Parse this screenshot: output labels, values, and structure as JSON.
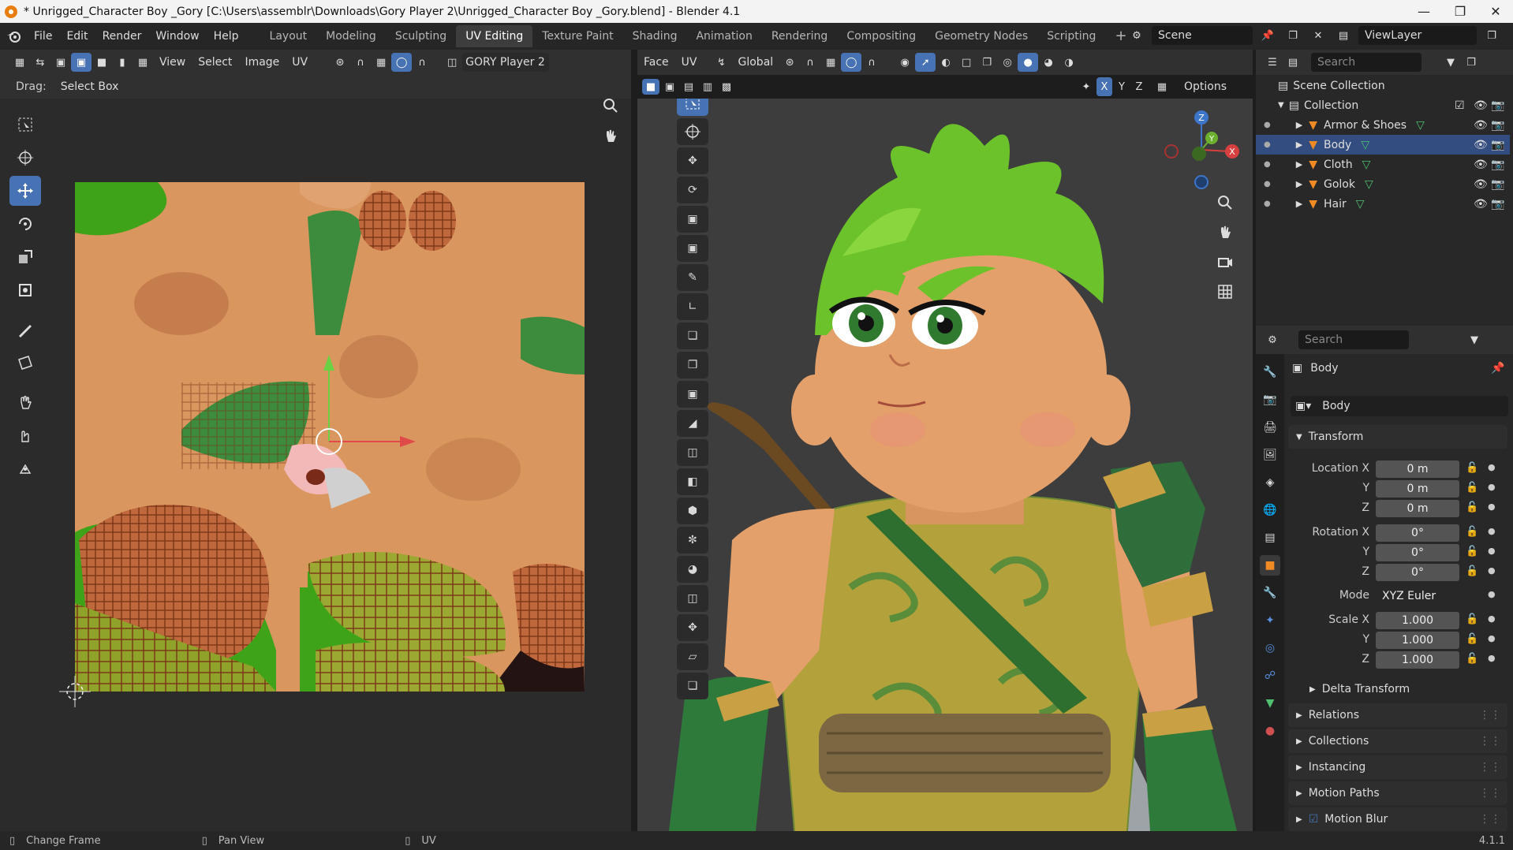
{
  "window": {
    "title": "* Unrigged_Character Boy _Gory [C:\\Users\\assemblr\\Downloads\\Gory Player 2\\Unrigged_Character Boy _Gory.blend] - Blender 4.1",
    "minimize": "—",
    "maximize": "❐",
    "close": "✕"
  },
  "menus": [
    "File",
    "Edit",
    "Render",
    "Window",
    "Help"
  ],
  "workspaces": [
    "Layout",
    "Modeling",
    "Sculpting",
    "UV Editing",
    "Texture Paint",
    "Shading",
    "Animation",
    "Rendering",
    "Compositing",
    "Geometry Nodes",
    "Scripting"
  ],
  "active_workspace": "UV Editing",
  "add_workspace": "+",
  "scene": {
    "label": "Scene",
    "view_layer": "ViewLayer"
  },
  "uv_editor": {
    "menus": [
      "View",
      "Select",
      "Image",
      "UV"
    ],
    "image_name": "GORY Player 2",
    "drag_label": "Drag:",
    "drag_value": "Select Box"
  },
  "viewport": {
    "mode": "Face",
    "menu_uv": "UV",
    "orientation": "Global",
    "options": "Options",
    "axes": [
      "X",
      "Y",
      "Z"
    ],
    "gizmo_labels": {
      "z": "Z",
      "x": "X",
      "y": "Y"
    }
  },
  "outliner": {
    "search_placeholder": "Search",
    "scene_collection": "Scene Collection",
    "collection": "Collection",
    "items": [
      {
        "name": "Armor & Shoes",
        "selected": false
      },
      {
        "name": "Body",
        "selected": true
      },
      {
        "name": "Cloth",
        "selected": false
      },
      {
        "name": "Golok",
        "selected": false
      },
      {
        "name": "Hair",
        "selected": false
      }
    ]
  },
  "properties": {
    "search_placeholder": "Search",
    "object_name": "Body",
    "datablock": "Body",
    "transform_title": "Transform",
    "location": {
      "x_label": "Location X",
      "y_label": "Y",
      "z_label": "Z",
      "x": "0 m",
      "y": "0 m",
      "z": "0 m"
    },
    "rotation": {
      "x_label": "Rotation X",
      "y_label": "Y",
      "z_label": "Z",
      "x": "0°",
      "y": "0°",
      "z": "0°"
    },
    "mode_label": "Mode",
    "mode_value": "XYZ Euler",
    "scale": {
      "x_label": "Scale X",
      "y_label": "Y",
      "z_label": "Z",
      "x": "1.000",
      "y": "1.000",
      "z": "1.000"
    },
    "panels": [
      "Delta Transform",
      "Relations",
      "Collections",
      "Instancing",
      "Motion Paths",
      "Motion Blur"
    ]
  },
  "statusbar": {
    "change_frame": "Change Frame",
    "pan_view": "Pan View",
    "uv": "UV",
    "version": "4.1.1"
  },
  "colors": {
    "accent": "#4772b3",
    "hair_green": "#6cc22a",
    "skin": "#e3a06a",
    "mesh_green": "#3a9a3a"
  }
}
